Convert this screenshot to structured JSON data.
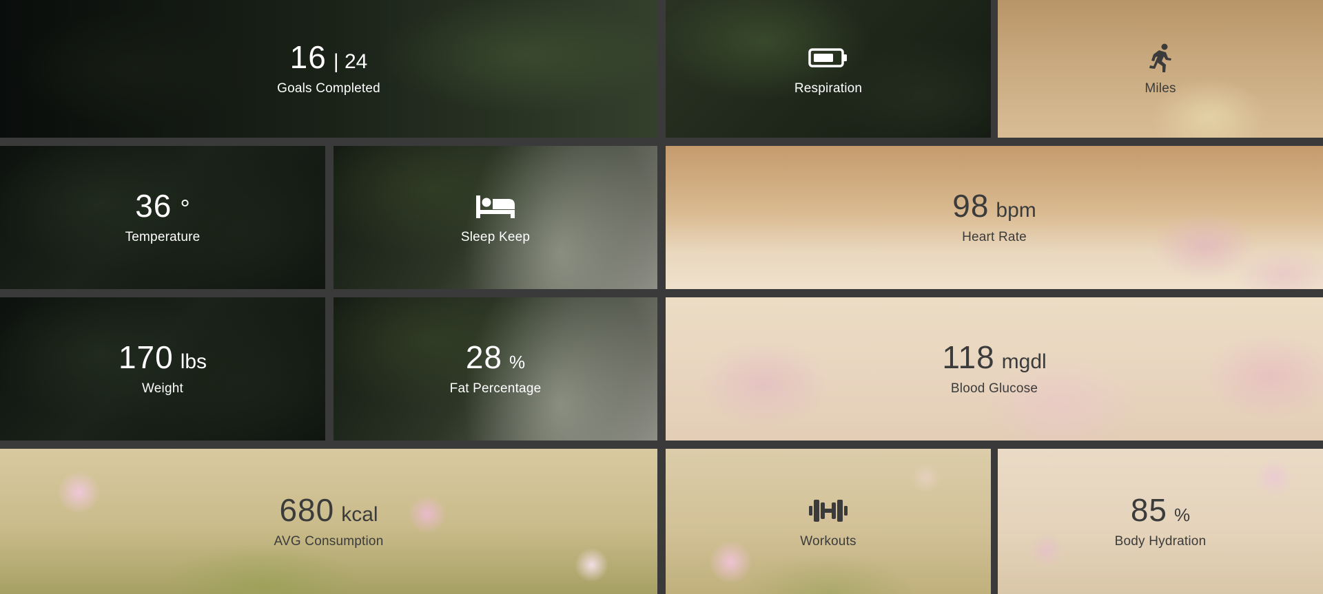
{
  "tiles": {
    "goals": {
      "value": "16",
      "secondary": "| 24",
      "label": "Goals Completed"
    },
    "respiration": {
      "icon": "battery-icon",
      "label": "Respiration"
    },
    "miles": {
      "icon": "running-person-icon",
      "label": "Miles"
    },
    "temperature": {
      "value": "36",
      "unit": "°",
      "label": "Temperature"
    },
    "sleep": {
      "icon": "bed-icon",
      "label": "Sleep Keep"
    },
    "heart_rate": {
      "value": "98",
      "unit": "bpm",
      "label": "Heart Rate"
    },
    "weight": {
      "value": "170",
      "unit": "lbs",
      "label": "Weight"
    },
    "fat": {
      "value": "28",
      "unit": "%",
      "label": "Fat Percentage"
    },
    "glucose": {
      "value": "118",
      "unit": "mgdl",
      "label": "Blood Glucose"
    },
    "consumption": {
      "value": "680",
      "unit": "kcal",
      "label": "AVG Consumption"
    },
    "workouts": {
      "icon": "dumbbell-icon",
      "label": "Workouts"
    },
    "hydration": {
      "value": "85",
      "unit": "%",
      "label": "Body Hydration"
    }
  },
  "colors": {
    "grid_gap": "#3a3a3a",
    "text_light": "#ffffff",
    "text_dark": "#3b3b3b"
  }
}
